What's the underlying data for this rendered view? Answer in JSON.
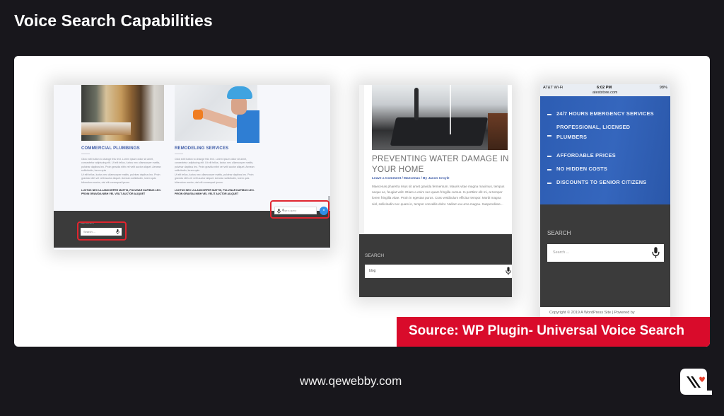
{
  "page": {
    "title": "Voice Search Capabilities",
    "source_label": "Source: WP Plugin- Universal Voice Search",
    "footer_url": "www.qewebby.com",
    "brand_color": "#d90b2b",
    "background_color": "#18171c"
  },
  "desktop_shot": {
    "services": [
      {
        "heading": "COMMERCIAL PLUMBINGS",
        "para1": "Click edit button to change this text. Lorem ipsum dolor sit amet, consectetur adipiscing elit. Ut elit tellus, luctus nec ullamcorper mattis, pulvinar dapibus leo. Proin gravida nibh vel velit auctor aliquet. Aenean sollicitudin, lorem quis",
        "para2": "Ut elit tellus, luctus nec ullamcorper mattis, pulvinar dapibus leo. Proin gravida nibh vel velit auctor aliquet. Aenean sollicitudin, lorem quis bibendum auctor, nisi elit consequat ipsum.",
        "bold": "LUCTUS NEC ULLAMCORPER MATTIS, PULVINAR DAPIBUS LEO. PROIN GRAVIDA NIBH VEL VELIT AUCTOR ALIQUET"
      },
      {
        "heading": "REMODELING SERVICES",
        "para1": "Click edit button to change this text. Lorem ipsum dolor sit amet, consectetur adipiscing elit. Ut elit tellus, luctus nec ullamcorper mattis, pulvinar dapibus leo. Proin gravida nibh vel velit auctor aliquet. Aenean sollicitudin, lorem quis",
        "para2": "Ut elit tellus, luctus nec ullamcorper mattis, pulvinar dapibus leo. Proin gravida nibh vel velit auctor aliquet. Aenean sollicitudin, lorem quis bibendum auctor, nisi elit consequat ipsum.",
        "bold": "LUCTUS NEC ULLAMCORPER MATTIS, PULVINAR DAPIBUS LEO. PROIN GRAVIDA NIBH VEL VELIT AUCTOR ALIQUET"
      }
    ],
    "search_label": "SEARCH",
    "search_placeholder": "Search ...",
    "widget_placeholder": "Type a query",
    "widget_close": "×",
    "search_glyph": "⌕"
  },
  "blog_shot": {
    "title": "PREVENTING WATER DAMAGE IN YOUR HOME",
    "meta": "Leave a Comment / Maecenas / By Jason Croyle",
    "excerpt": "Maecenas pharetra risus sit amet gravida fermentum. Mauris vitae magna maximus, tempus neque ac, feugiat velit. Etiam a enim nec quam fringilla cursus. In porttitor elit mi, at tempor lorem fringilla vitae. Proin in egestas purus. Cras vestibulum efficitur tempor. Morbi magna nisl, sollicitudin nec quam in, tempor convallis dolor. Nullam eu urna magna. Suspendisse...",
    "search_label": "SEARCH",
    "search_value": "blog"
  },
  "mobile_shot": {
    "status": {
      "carrier": "AT&T Wi-Fi",
      "time": "6:02 PM",
      "battery": "98%",
      "url": "ateststore.com"
    },
    "features": [
      "24/7 HOURS EMERGENCY SERVICES",
      "PROFESSIONAL, LICENSED PLUMBERS",
      "AFFORDABLE PRICES",
      "NO HIDDEN COSTS",
      "DISCOUNTS TO SENIOR CITIZENS"
    ],
    "search_label": "SEARCH",
    "search_placeholder": "Search ...",
    "copyright": "Copyright © 2019 A WordPress Site | Powered by"
  }
}
